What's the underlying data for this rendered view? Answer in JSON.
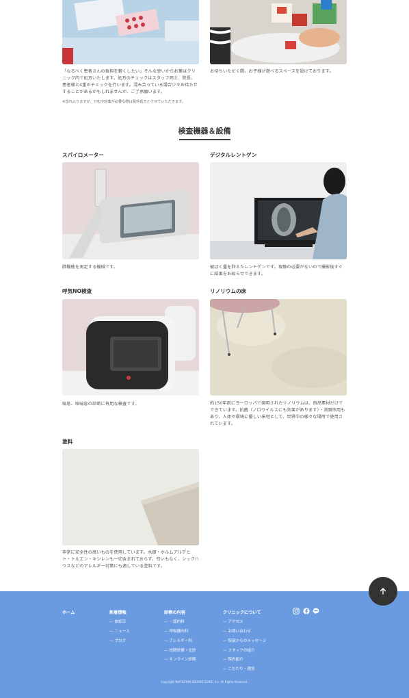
{
  "top_captions": {
    "left": "「なるべく患者さんの負担を軽くしたい」そんな思いからお薬はクリニック内で処方いたします。処方のチェックはスタッフ同士、院長、患者様と4重のチェックを行います。混み合っている場合少々お待たせすることがあるかもしれませんが、ご了承願います。",
    "left_note": "※恐れ入りますが、分包や粉薬が必要な際は院外処方とさせていただきます。",
    "right": "お待ちいただく間、お子様が遊べるスペースを設けております。"
  },
  "section": {
    "title": "検査機器＆設備"
  },
  "equipment": [
    {
      "title": "スパイロメーター",
      "description": "肺機能を測定する機械です。"
    },
    {
      "title": "デジタルレントゲン",
      "description": "被ばく量を抑えたレントゲンです。現像の必要がないので撮影後すぐに結果をお知らせできます。"
    },
    {
      "title": "呼気NO検査",
      "description": "喘息、咳喘息の診断に有用な検査です。"
    },
    {
      "title": "リノリウムの床",
      "description": "約150年前にヨーロッパで発明されたリノリウムは、自然素材だけでできています。抗菌（ノロウイルスにも効果があります）・消臭作用もあり、人体や環境に優しい床材として、世界中の様々な場所で使用されています。"
    },
    {
      "title": "塗料",
      "description": "非常に安全性の高いものを使用しています。水銀・ホルムアルデヒト・トルエン・キシレンも一切含まれておらず、匂いもなく、シックハウスなどのアレルギー対策にも適している塗料です。"
    }
  ],
  "footer": {
    "home": "ホーム",
    "news": {
      "heading": "新着情報",
      "links": [
        "休診日",
        "ニュース",
        "ブログ"
      ]
    },
    "services": {
      "heading": "診察の内容",
      "links": [
        "一般内科",
        "呼吸器内科",
        "アレルギー科",
        "訪問診療・往診",
        "オンライン診断"
      ]
    },
    "about": {
      "heading": "クリニックについて",
      "links": [
        "アクセス",
        "お問い合わせ",
        "院長からのメッセージ",
        "スタッフの紹介",
        "院内紹介",
        "こだわり・理念"
      ]
    },
    "social_icons": [
      "instagram-icon",
      "facebook-icon",
      "line-icon"
    ],
    "copyright": "Copyright NHITSUYAN SQUARE CLINIC, Inc. All Rights Reserved."
  },
  "colors": {
    "footer_bg": "#6a9ae0",
    "to_top_bg": "#333333"
  }
}
